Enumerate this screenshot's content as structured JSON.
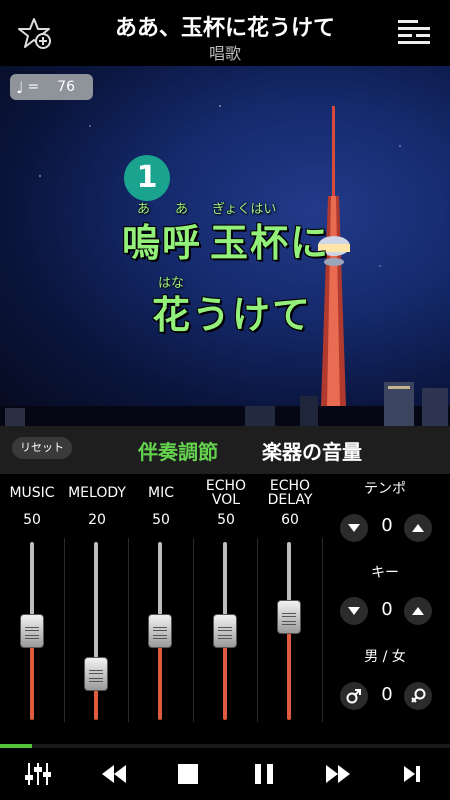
{
  "header": {
    "title": "ああ、玉杯に花うけて",
    "genre": "唱歌",
    "favorite_icon": "star-plus-icon",
    "menu_icon": "lyrics-menu-icon"
  },
  "player": {
    "tempo_badge_value": "76",
    "tempo_badge_eq": "=",
    "verse_number": "1",
    "lyrics": {
      "line1": {
        "text_a": "嗚呼",
        "text_b": "玉杯に",
        "ruby_a": "あ",
        "ruby_b": "あ",
        "ruby_c": "ぎょくはい"
      },
      "line2": {
        "text": "花うけて",
        "ruby": "はな"
      }
    }
  },
  "mixer": {
    "reset_label": "リセット",
    "tabs": [
      "伴奏調節",
      "楽器の音量"
    ],
    "active_tab": 0,
    "channels": [
      {
        "name": "MUSIC",
        "value": 50
      },
      {
        "name": "MELODY",
        "value": 20
      },
      {
        "name": "MIC",
        "value": 50
      },
      {
        "name": "ECHO VOL",
        "name_l1": "ECHO",
        "name_l2": "VOL",
        "value": 50
      },
      {
        "name": "ECHO DELAY",
        "name_l1": "ECHO",
        "name_l2": "DELAY",
        "value": 60
      }
    ],
    "tempo": {
      "label": "テンポ",
      "value": "0"
    },
    "key": {
      "label": "キー",
      "value": "0"
    },
    "gender": {
      "label": "男 / 女",
      "value": "0"
    }
  },
  "transport": {
    "progress": 0.07,
    "icons": [
      "mixer-sliders-icon",
      "rewind-icon",
      "stop-icon",
      "pause-icon",
      "fast-forward-icon",
      "skip-next-icon"
    ]
  },
  "colors": {
    "accent_green": "#64d24f",
    "lyric_green": "#93f07a",
    "verse_badge": "#1aa38f",
    "slider_bottom": "#e05a3c"
  }
}
